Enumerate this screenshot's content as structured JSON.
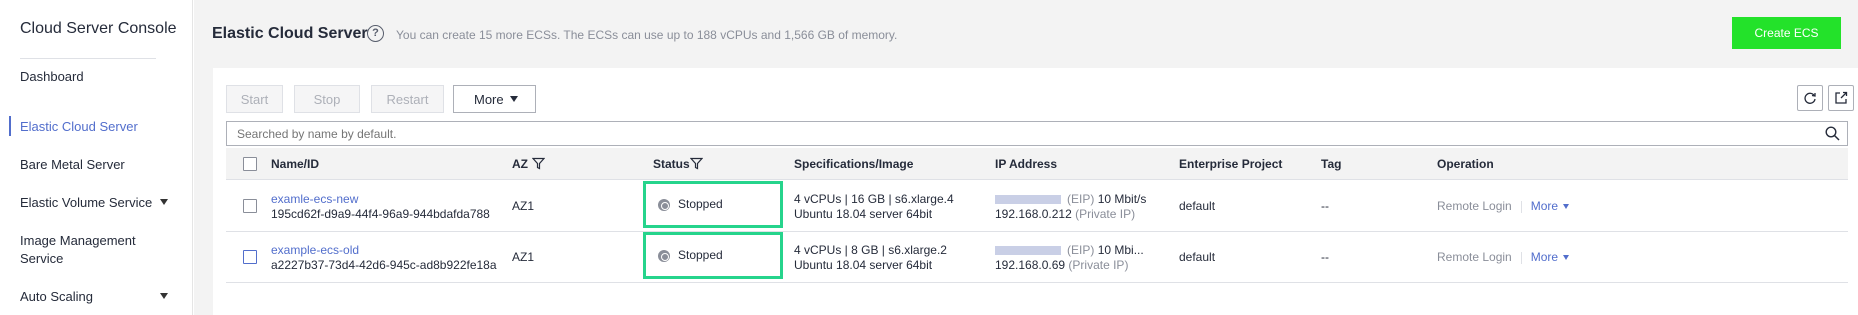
{
  "sidebar": {
    "title": "Cloud Server Console",
    "items": [
      {
        "label": "Dashboard"
      },
      {
        "label": "Elastic Cloud Server"
      },
      {
        "label": "Bare Metal Server"
      },
      {
        "label": "Elastic Volume Service"
      },
      {
        "label": "Image Management Service"
      },
      {
        "label": "Auto Scaling"
      }
    ]
  },
  "header": {
    "title": "Elastic Cloud Server",
    "help_icon": "?",
    "quota": "You can create 15 more ECSs. The ECSs can use up to 188 vCPUs and 1,566 GB of memory.",
    "create_button": "Create ECS"
  },
  "toolbar": {
    "start": "Start",
    "stop": "Stop",
    "restart": "Restart",
    "more": "More"
  },
  "search": {
    "placeholder": "Searched by name by default."
  },
  "table": {
    "columns": [
      "Name/ID",
      "AZ",
      "Status",
      "Specifications/Image",
      "IP Address",
      "Enterprise Project",
      "Tag",
      "Operation"
    ],
    "rows": [
      {
        "name": "examle-ecs-new",
        "id": "195cd62f-d9a9-44f4-96a9-944bdafda788",
        "az": "AZ1",
        "status": "Stopped",
        "spec": "4 vCPUs | 16 GB | s6.xlarge.4",
        "image": "Ubuntu 18.04 server 64bit",
        "eip_tag": "(EIP)",
        "bandwidth": "10 Mbit/s",
        "private_ip": "192.168.0.212",
        "private_tag": "(Private IP)",
        "project": "default",
        "tag": "--",
        "remote_login": "Remote Login",
        "more": "More"
      },
      {
        "name": "example-ecs-old",
        "id": "a2227b37-73d4-42d6-945c-ad8b922fe18a",
        "az": "AZ1",
        "status": "Stopped",
        "spec": "4 vCPUs | 8 GB | s6.xlarge.2",
        "image": "Ubuntu 18.04 server 64bit",
        "eip_tag": "(EIP)",
        "bandwidth": "10 Mbi...",
        "private_ip": "192.168.0.69",
        "private_tag": "(Private IP)",
        "project": "default",
        "tag": "--",
        "remote_login": "Remote Login",
        "more": "More"
      }
    ]
  },
  "colors": {
    "accent": "#526ecc",
    "create_button": "#23e22a",
    "status_highlight": "#26d48c"
  }
}
